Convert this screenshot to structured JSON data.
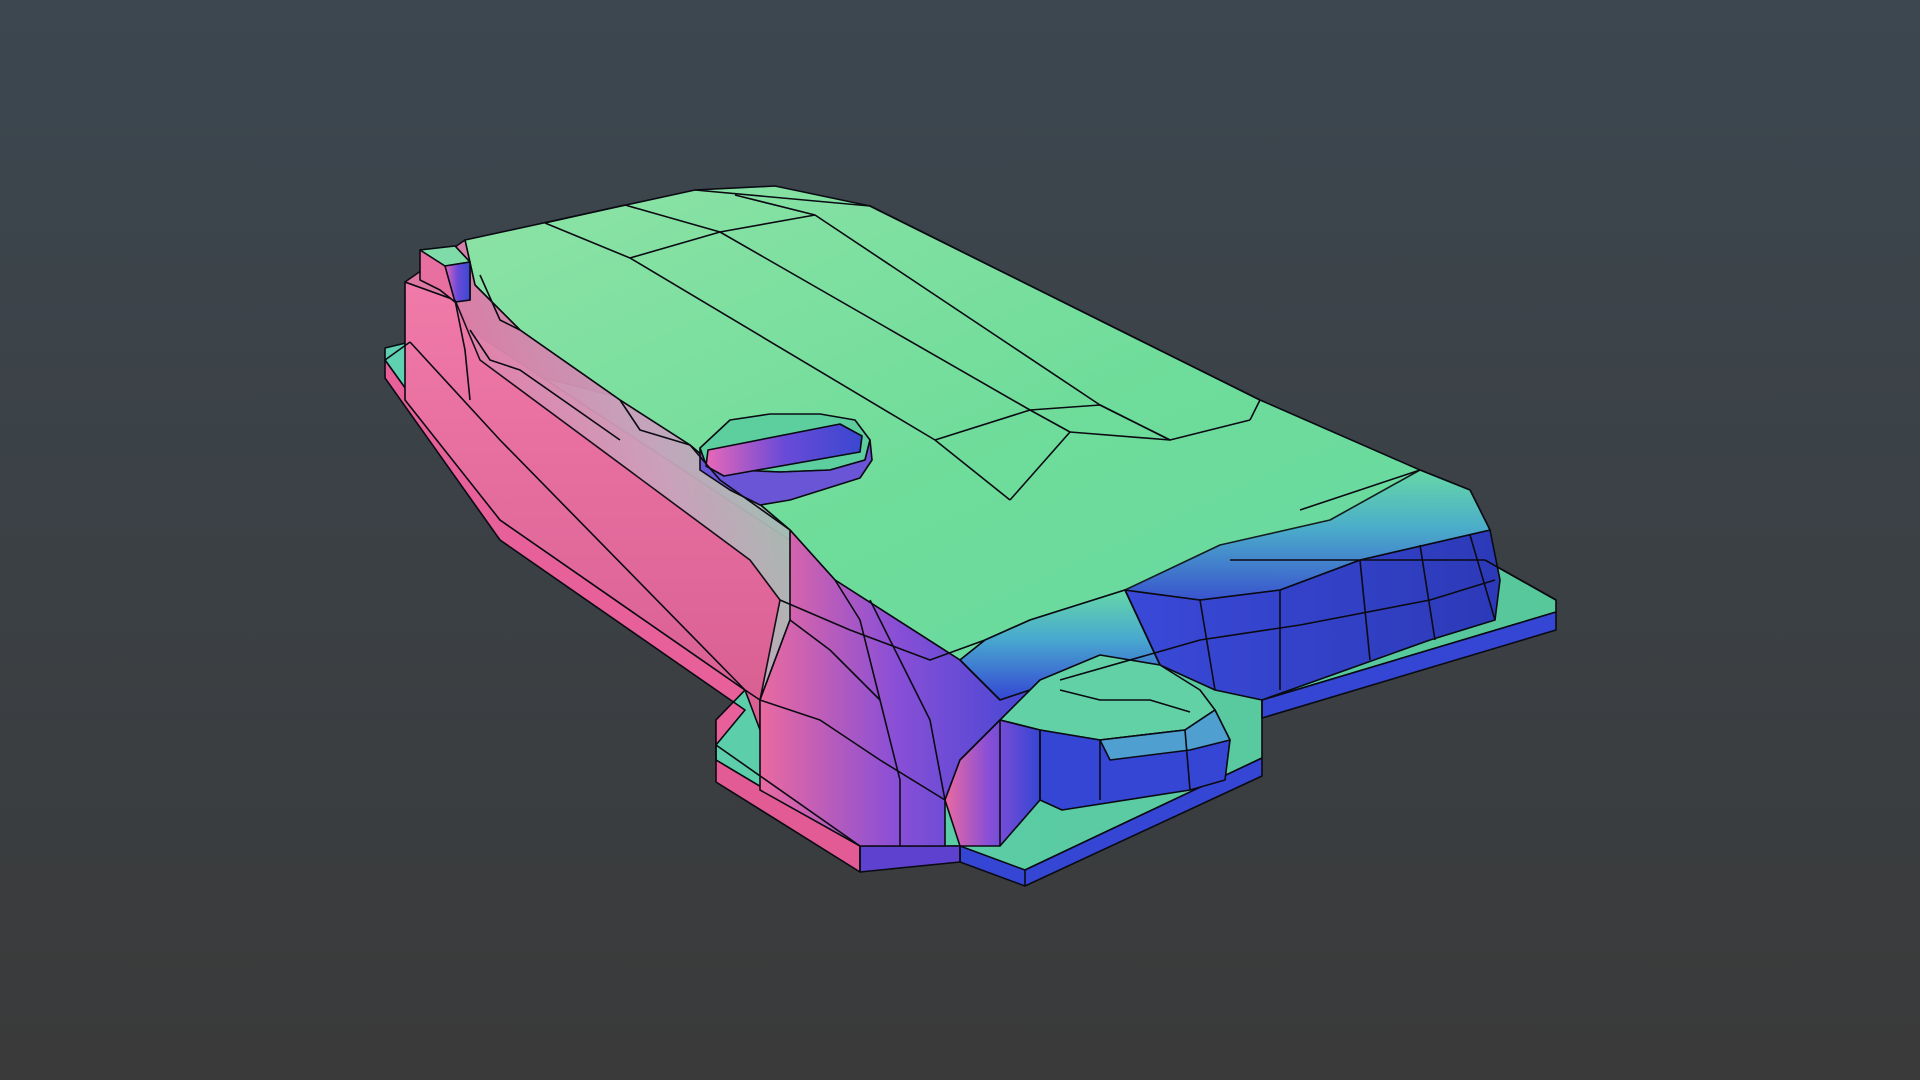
{
  "viewport": {
    "background_top": "#3c4750",
    "background_bottom": "#3a3a3a",
    "wire_color": "#0a0a12"
  },
  "model": {
    "shading": "normal-map",
    "wireframe_overlay": true,
    "palette": {
      "normal_up": "#6edc9a",
      "normal_up_light": "#8de3a6",
      "normal_left": "#e8659a",
      "normal_left_light": "#f07aa8",
      "normal_front": "#3546d4",
      "normal_front_dark": "#2c3ab8",
      "normal_mix": "#8a4fd6",
      "normal_teal": "#5fd0b0"
    }
  }
}
